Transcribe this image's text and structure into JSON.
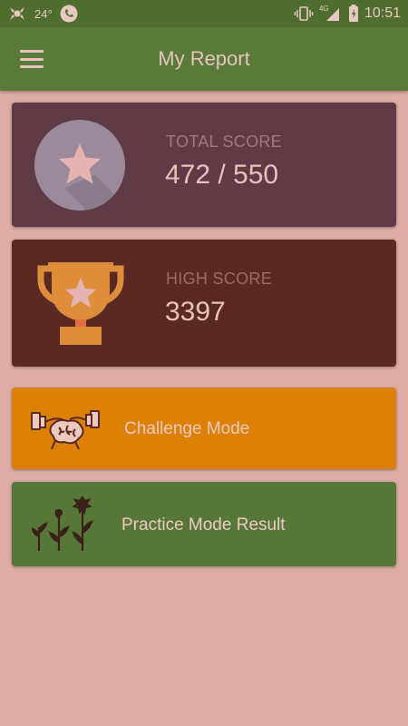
{
  "status_bar": {
    "temperature": "24°",
    "network": "4G",
    "time": "10:51",
    "icons": [
      "app-notification-icon",
      "phone-icon",
      "vibrate-icon",
      "signal-icon",
      "battery-icon"
    ]
  },
  "app_bar": {
    "title": "My Report",
    "menu_icon": "hamburger-menu-icon"
  },
  "total_score": {
    "label": "TOTAL SCORE",
    "value": "472 / 550",
    "icon": "star-circle-icon"
  },
  "high_score": {
    "label": "HIGH SCORE",
    "value": "3397",
    "icon": "trophy-icon"
  },
  "challenge": {
    "label": "Challenge Mode",
    "icon": "brain-dumbbell-icon"
  },
  "practice": {
    "label": "Practice Mode Result",
    "icon": "growing-plants-icon"
  },
  "colors": {
    "background": "#ddaca5",
    "app_bar": "#5a7a3a",
    "total_card": "#5f3b45",
    "high_card": "#5a2a22",
    "challenge_card": "#dc8106",
    "practice_card": "#577738"
  }
}
